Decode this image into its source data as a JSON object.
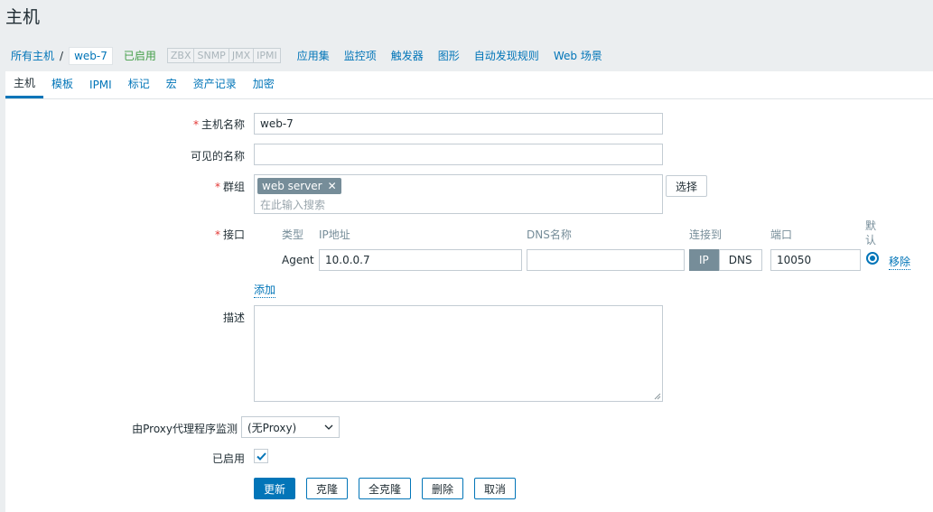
{
  "page": {
    "title": "主机"
  },
  "breadcrumb": {
    "all_hosts": "所有主机",
    "separator": "/",
    "current_host": "web-7",
    "status": "已启用"
  },
  "availability": [
    "ZBX",
    "SNMP",
    "JMX",
    "IPMI"
  ],
  "host_menu": [
    "应用集",
    "监控项",
    "触发器",
    "图形",
    "自动发现规则",
    "Web 场景"
  ],
  "tabs": [
    {
      "label": "主机",
      "active": true
    },
    {
      "label": "模板"
    },
    {
      "label": "IPMI"
    },
    {
      "label": "标记"
    },
    {
      "label": "宏"
    },
    {
      "label": "资产记录"
    },
    {
      "label": "加密"
    }
  ],
  "form": {
    "required_mark": "*",
    "hostname": {
      "label": "主机名称",
      "value": "web-7"
    },
    "visible_name": {
      "label": "可见的名称",
      "value": ""
    },
    "groups": {
      "label": "群组",
      "tag": "web server",
      "tag_remove": "✕",
      "placeholder": "在此输入搜索",
      "select_label": "选择"
    },
    "interfaces": {
      "label": "接口",
      "headers": {
        "type": "类型",
        "ip": "IP地址",
        "dns": "DNS名称",
        "connect": "连接到",
        "port": "端口",
        "default": "默认"
      },
      "row": {
        "type": "Agent",
        "ip": "10.0.0.7",
        "dns": "",
        "connect_ip": "IP",
        "connect_dns": "DNS",
        "connect_selected": "IP",
        "port": "10050",
        "remove": "移除"
      },
      "add": "添加"
    },
    "description": {
      "label": "描述",
      "value": ""
    },
    "proxy": {
      "label": "由Proxy代理程序监测",
      "value": "(无Proxy)"
    },
    "enabled": {
      "label": "已启用",
      "checked": true
    }
  },
  "actions": {
    "update": "更新",
    "clone": "克隆",
    "full_clone": "全克隆",
    "delete": "删除",
    "cancel": "取消"
  },
  "colors": {
    "accent": "#0275b8",
    "enabled": "#429e47",
    "required": "#e33734",
    "tag_bg": "#768d99"
  }
}
